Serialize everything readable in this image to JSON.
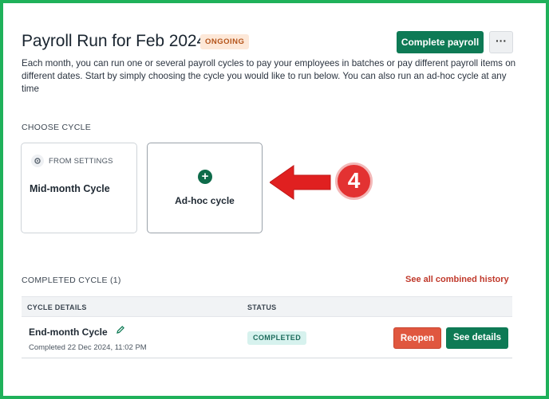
{
  "header": {
    "title": "Payroll Run for Feb 2024",
    "status_badge": "ONGOING",
    "complete_button": "Complete payroll",
    "more_button": "···"
  },
  "description": "Each month, you can run one or several payroll cycles to pay your employees in batches or pay different payroll items on different dates. Start by simply choosing the cycle you would like to run below. You can also run an ad-hoc cycle at any time",
  "choose_cycle": {
    "heading": "CHOOSE CYCLE",
    "cards": [
      {
        "tag": "FROM SETTINGS",
        "tag_icon": "gear-icon",
        "title": "Mid-month Cycle"
      },
      {
        "icon": "plus-circle-icon",
        "title": "Ad-hoc cycle"
      }
    ]
  },
  "annotation": {
    "step_number": "4",
    "arrow_color": "#e02020"
  },
  "completed_cycle": {
    "heading": "COMPLETED CYCLE (1)",
    "history_link": "See all combined history",
    "columns": [
      "CYCLE DETAILS",
      "STATUS"
    ],
    "rows": [
      {
        "name": "End-month Cycle",
        "date": "Completed 22 Dec 2024, 11:02 PM",
        "status": "COMPLETED",
        "reopen_label": "Reopen",
        "details_label": "See details"
      }
    ]
  },
  "colors": {
    "primary": "#0e7a55",
    "danger": "#e0573f",
    "frame_border": "#1fb15a"
  }
}
